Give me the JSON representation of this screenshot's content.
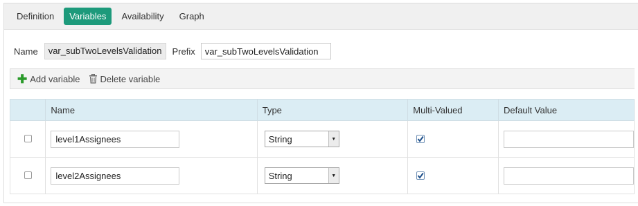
{
  "tabs": [
    {
      "label": "Definition",
      "active": false
    },
    {
      "label": "Variables",
      "active": true
    },
    {
      "label": "Availability",
      "active": false
    },
    {
      "label": "Graph",
      "active": false
    }
  ],
  "form": {
    "name_label": "Name",
    "name_value": "var_subTwoLevelsValidation",
    "prefix_label": "Prefix",
    "prefix_value": "var_subTwoLevelsValidation"
  },
  "toolbar": {
    "add_label": "Add variable",
    "delete_label": "Delete variable",
    "add_icon": "plus-icon",
    "delete_icon": "trash-icon"
  },
  "table": {
    "headers": [
      "Name",
      "Type",
      "Multi-Valued",
      "Default Value"
    ],
    "rows": [
      {
        "selected": false,
        "name": "level1Assignees",
        "type": "String",
        "multi_valued": true,
        "default_value": ""
      },
      {
        "selected": false,
        "name": "level2Assignees",
        "type": "String",
        "multi_valued": true,
        "default_value": ""
      }
    ]
  },
  "colors": {
    "accent": "#1d9a7b",
    "header_bg": "#dbedf4",
    "add_icon": "#2a9a2a"
  }
}
